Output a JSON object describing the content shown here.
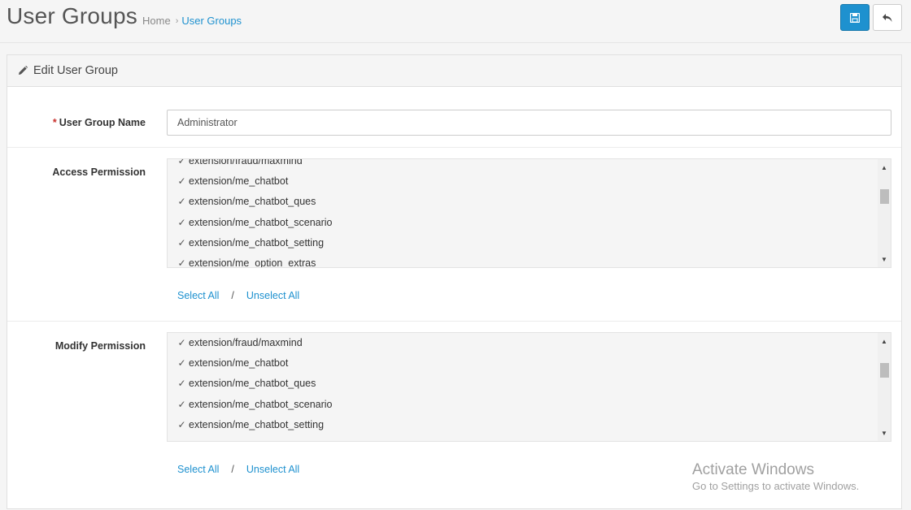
{
  "header": {
    "title": "User Groups",
    "breadcrumb": {
      "home": "Home",
      "separator": "›",
      "current": "User Groups"
    }
  },
  "buttons": {
    "save_icon": "save-icon",
    "back_icon": "reply-icon"
  },
  "panel": {
    "heading": "Edit User Group",
    "heading_icon": "pencil-icon"
  },
  "form": {
    "name": {
      "required_mark": "*",
      "label": "User Group Name",
      "value": "Administrator"
    },
    "access": {
      "label": "Access Permission",
      "items": [
        "extension/fraud/maxmind",
        "extension/me_chatbot",
        "extension/me_chatbot_ques",
        "extension/me_chatbot_scenario",
        "extension/me_chatbot_setting",
        "extension/me_option_extras"
      ],
      "select_all": "Select All",
      "separator": "/",
      "unselect_all": "Unselect All"
    },
    "modify": {
      "label": "Modify Permission",
      "items": [
        "extension/fraud/maxmind",
        "extension/me_chatbot",
        "extension/me_chatbot_ques",
        "extension/me_chatbot_scenario",
        "extension/me_chatbot_setting"
      ],
      "select_all": "Select All",
      "separator": "/",
      "unselect_all": "Unselect All"
    }
  },
  "watermark": {
    "line1": "Activate Windows",
    "line2": "Go to Settings to activate Windows."
  },
  "colors": {
    "accent": "#1e91cf",
    "required": "#c9302c"
  }
}
